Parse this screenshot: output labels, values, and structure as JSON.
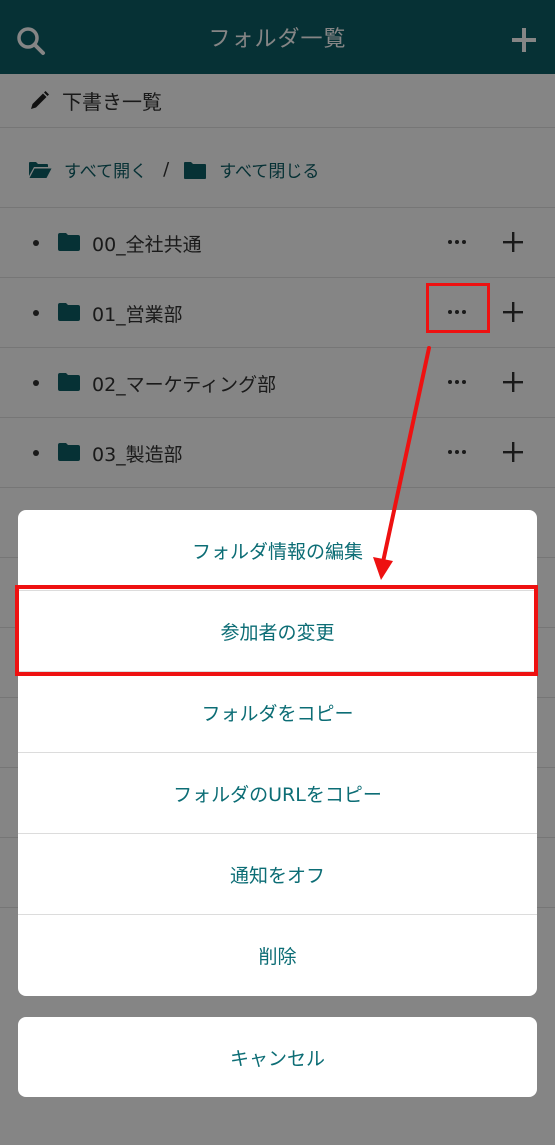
{
  "header": {
    "title": "フォルダ一覧",
    "search_icon": "search-icon",
    "add_icon": "plus-icon"
  },
  "drafts": {
    "label": "下書き一覧",
    "icon": "pencil-icon"
  },
  "toolbar": {
    "open_all": "すべて開く",
    "separator": "/",
    "close_all": "すべて閉じる"
  },
  "folders": [
    {
      "name": "00_全社共通"
    },
    {
      "name": "01_営業部"
    },
    {
      "name": "02_マーケティング部"
    },
    {
      "name": "03_製造部"
    }
  ],
  "action_sheet": {
    "items": [
      {
        "label": "フォルダ情報の編集"
      },
      {
        "label": "参加者の変更"
      },
      {
        "label": "フォルダをコピー"
      },
      {
        "label": "フォルダのURLをコピー"
      },
      {
        "label": "通知をオフ"
      },
      {
        "label": "削除"
      }
    ],
    "cancel": "キャンセル"
  },
  "colors": {
    "brand": "#0c5e66",
    "accent_text": "#0c6d75",
    "annotation": "#ee1111"
  }
}
